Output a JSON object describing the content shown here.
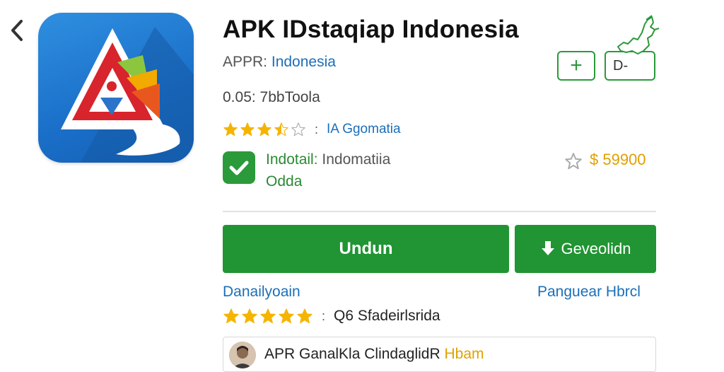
{
  "app": {
    "title": "APK IDstaqiap Indonesia",
    "publisher_prefix": "APPR: ",
    "publisher_link": "Indonesia",
    "version": "0.05: 7bbToola"
  },
  "rating": {
    "stars": 3.5,
    "separator": ":",
    "label": "IA Ggomatia"
  },
  "install": {
    "label_prefix": "Indotail: ",
    "label_value": "Indomatiia",
    "sub": "Odda"
  },
  "price": "$ 59900",
  "actions": {
    "plus_label": "+",
    "d_label": "D-",
    "primary_label": "Undun",
    "secondary_label": "Geveolidn"
  },
  "links": {
    "left": "Danailyoain",
    "right": "Panguear Hbrcl"
  },
  "reviews": {
    "stars": 5,
    "separator": ":",
    "count_label": "Q6 Sfadeirlsrida",
    "first_review_text": "APR GanalKla ClindaglidR",
    "first_review_tag": " Hbam"
  },
  "colors": {
    "accent_green": "#219433",
    "link_blue": "#1b6fb8",
    "star_gold": "#f5b400",
    "price_gold": "#e0a000"
  },
  "icons": [
    "back-chevron-icon",
    "app-logo-icon",
    "plus-icon",
    "map-icon",
    "check-icon",
    "star-outline-icon",
    "download-icon",
    "avatar-icon"
  ]
}
